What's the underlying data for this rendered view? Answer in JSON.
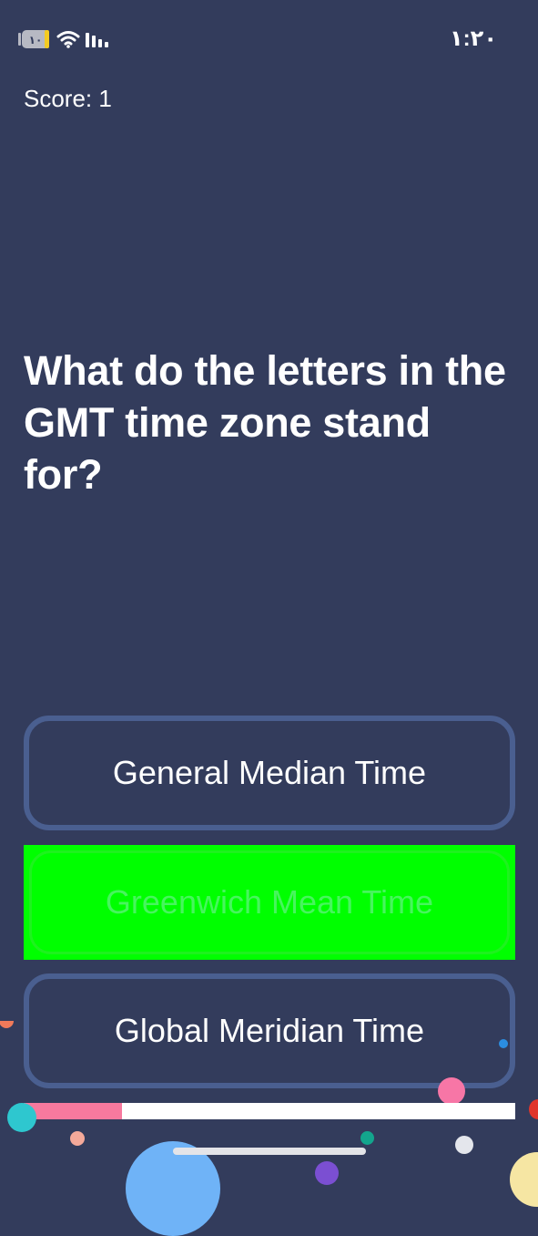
{
  "status_bar": {
    "time": "١:٢٠",
    "battery_level_text": "١٠",
    "icons": [
      "battery-icon",
      "wifi-icon",
      "signal-icon"
    ]
  },
  "score": {
    "label": "Score: 1"
  },
  "question": {
    "text": "What do the letters in the GMT time zone stand for?"
  },
  "answers": [
    {
      "label": "General Median Time",
      "state": "default"
    },
    {
      "label": "Greenwich Mean Time",
      "state": "correct"
    },
    {
      "label": "Global Meridian Time",
      "state": "default"
    }
  ],
  "progress": {
    "fraction": 0.2
  },
  "colors": {
    "background": "#333c5c",
    "answer_border": "#4a5f90",
    "correct_fill": "#00ff00",
    "correct_text": "#47f55e",
    "progress_fill": "#f7799e",
    "progress_track": "#ffffff"
  }
}
